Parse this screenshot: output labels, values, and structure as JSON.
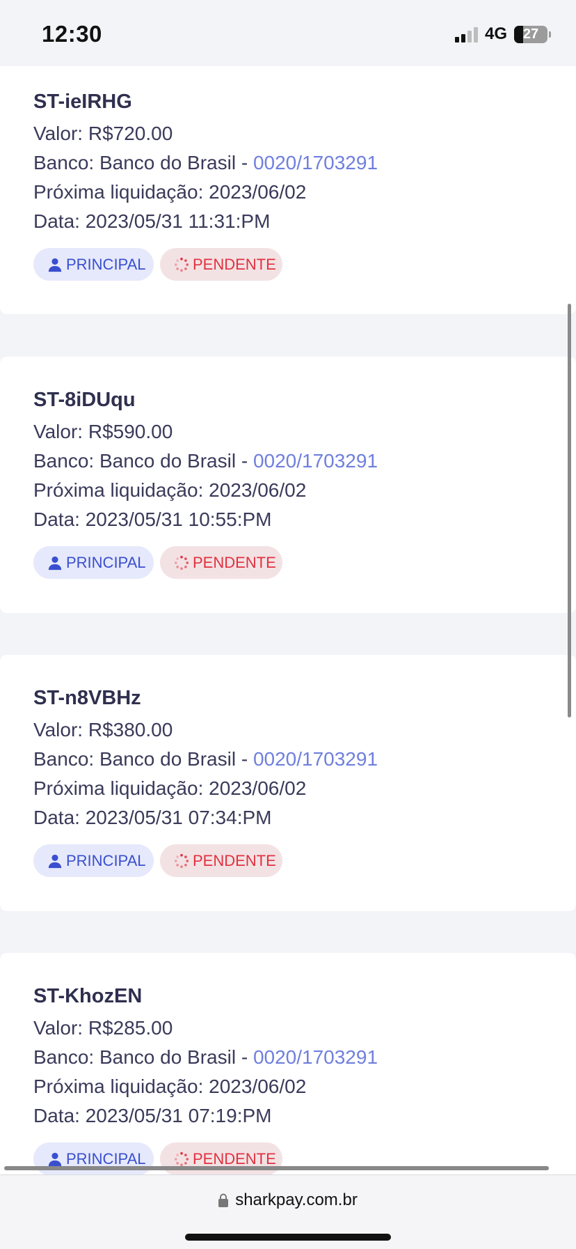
{
  "status_bar": {
    "time": "12:30",
    "network": "4G",
    "battery": "27",
    "battery_level_percent": 27
  },
  "labels": {
    "valor_prefix": "Valor: ",
    "banco_prefix": "Banco: ",
    "banco_separator": " - ",
    "proxima_prefix": "Próxima liquidação: ",
    "data_prefix": "Data: "
  },
  "transactions": [
    {
      "id": "ST-ieIRHG",
      "valor": "R$720.00",
      "banco": "Banco do Brasil",
      "conta": "0020/1703291",
      "proxima_liquidacao": "2023/06/02",
      "data": "2023/05/31 11:31:PM",
      "badges": [
        "PRINCIPAL",
        "PENDENTE"
      ]
    },
    {
      "id": "ST-8iDUqu",
      "valor": "R$590.00",
      "banco": "Banco do Brasil",
      "conta": "0020/1703291",
      "proxima_liquidacao": "2023/06/02",
      "data": "2023/05/31 10:55:PM",
      "badges": [
        "PRINCIPAL",
        "PENDENTE"
      ]
    },
    {
      "id": "ST-n8VBHz",
      "valor": "R$380.00",
      "banco": "Banco do Brasil",
      "conta": "0020/1703291",
      "proxima_liquidacao": "2023/06/02",
      "data": "2023/05/31 07:34:PM",
      "badges": [
        "PRINCIPAL",
        "PENDENTE"
      ]
    },
    {
      "id": "ST-KhozEN",
      "valor": "R$285.00",
      "banco": "Banco do Brasil",
      "conta": "0020/1703291",
      "proxima_liquidacao": "2023/06/02",
      "data": "2023/05/31 07:19:PM",
      "badges": [
        "PRINCIPAL",
        "PENDENTE"
      ]
    }
  ],
  "browser": {
    "url": "sharkpay.com.br"
  },
  "icons": {
    "principal": "user-icon",
    "pendente": "spinner-icon",
    "url": "lock-icon"
  },
  "colors": {
    "link": "#6f7fdd",
    "principal_text": "#3a4fcf",
    "principal_bg": "#e6e9fb",
    "pendente_text": "#e0313f",
    "pendente_bg": "#f3e2e4"
  }
}
